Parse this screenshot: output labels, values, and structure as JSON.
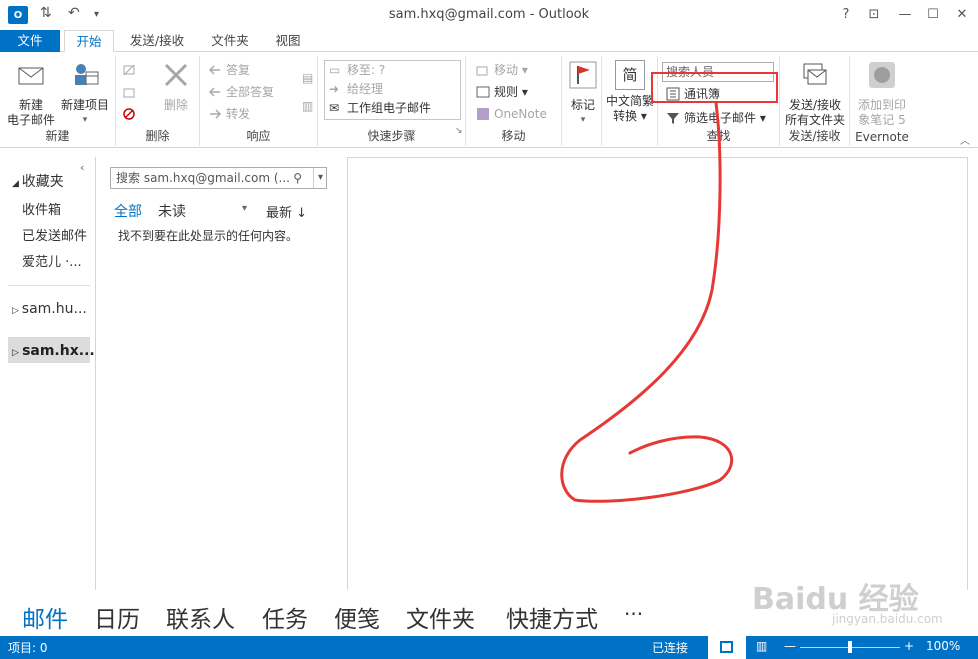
{
  "window": {
    "title": "sam.hxq@gmail.com - Outlook",
    "app_icon": "O",
    "help": "?"
  },
  "tabs": [
    "文件",
    "开始",
    "发送/接收",
    "文件夹",
    "视图"
  ],
  "ribbon": {
    "new_group": {
      "label": "新建",
      "new_email": "新建\n电子邮件",
      "new_items": "新建项目"
    },
    "delete_group": {
      "label": "删除",
      "delete": "删除"
    },
    "respond_group": {
      "label": "响应",
      "reply": "答复",
      "reply_all": "全部答复",
      "forward": "转发"
    },
    "quick_steps": {
      "label": "快速步骤",
      "items": [
        "移至: ?",
        "给经理",
        "工作组电子邮件"
      ]
    },
    "move_group": {
      "label": "移动",
      "move": "移动",
      "rules": "规则",
      "onenote": "OneNote"
    },
    "tags_group": {
      "flag": "标记"
    },
    "chinese_group": {
      "convert_line1": "中文简繁",
      "convert_line2": "转换",
      "glyph": "简"
    },
    "find_group": {
      "label": "查找",
      "search_people": "搜索人员",
      "address_book": "通讯簿",
      "filter_email": "筛选电子邮件"
    },
    "sendrecv_group": {
      "label": "发送/接收",
      "btn_line1": "发送/接收",
      "btn_line2": "所有文件夹"
    },
    "evernote_group": {
      "label": "Evernote",
      "btn_line1": "添加到印",
      "btn_line2": "象笔记 5"
    }
  },
  "nav": {
    "favorites": "收藏夹",
    "items": [
      "收件箱",
      "已发送邮件",
      "爱范儿 ·..."
    ],
    "accounts": [
      "sam.hu...",
      "sam.hx..."
    ]
  },
  "list": {
    "search_placeholder": "搜索 sam.hxq@gmail.com (...",
    "filter_all": "全部",
    "filter_unread": "未读",
    "sort": "最新 ↓",
    "empty_message": "找不到要在此处显示的任何内容。"
  },
  "bottom_nav": [
    "邮件",
    "日历",
    "联系人",
    "任务",
    "便笺",
    "文件夹",
    "快捷方式",
    "···"
  ],
  "status": {
    "items": "项目: 0",
    "connection": "已连接",
    "zoom": "100%"
  },
  "watermark": {
    "brand": "Baidu 经验",
    "url": "jingyan.baidu.com"
  },
  "colors": {
    "accent": "#0072c6",
    "annotation": "#e53935"
  }
}
